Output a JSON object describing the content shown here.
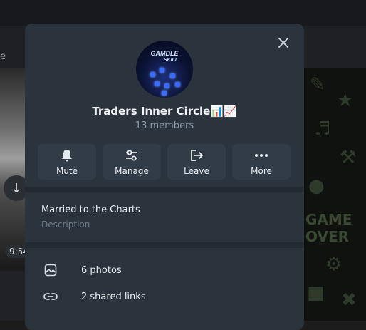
{
  "background": {
    "left_text": "e",
    "time": "9:54"
  },
  "modal": {
    "avatar_text_top": "GAMBLE",
    "avatar_text_bottom": "SKILL",
    "title": "Traders Inner Circle📊📈",
    "members": "13 members",
    "actions": [
      {
        "label": "Mute",
        "icon": "bell-icon"
      },
      {
        "label": "Manage",
        "icon": "sliders-icon"
      },
      {
        "label": "Leave",
        "icon": "leave-icon"
      },
      {
        "label": "More",
        "icon": "more-icon"
      }
    ],
    "description": {
      "text": "Married to the Charts",
      "label": "Description"
    },
    "media": [
      {
        "label": "6 photos",
        "icon": "photo-icon"
      },
      {
        "label": "2 shared links",
        "icon": "link-icon"
      }
    ]
  },
  "right_panel_text": "GAME OVER"
}
